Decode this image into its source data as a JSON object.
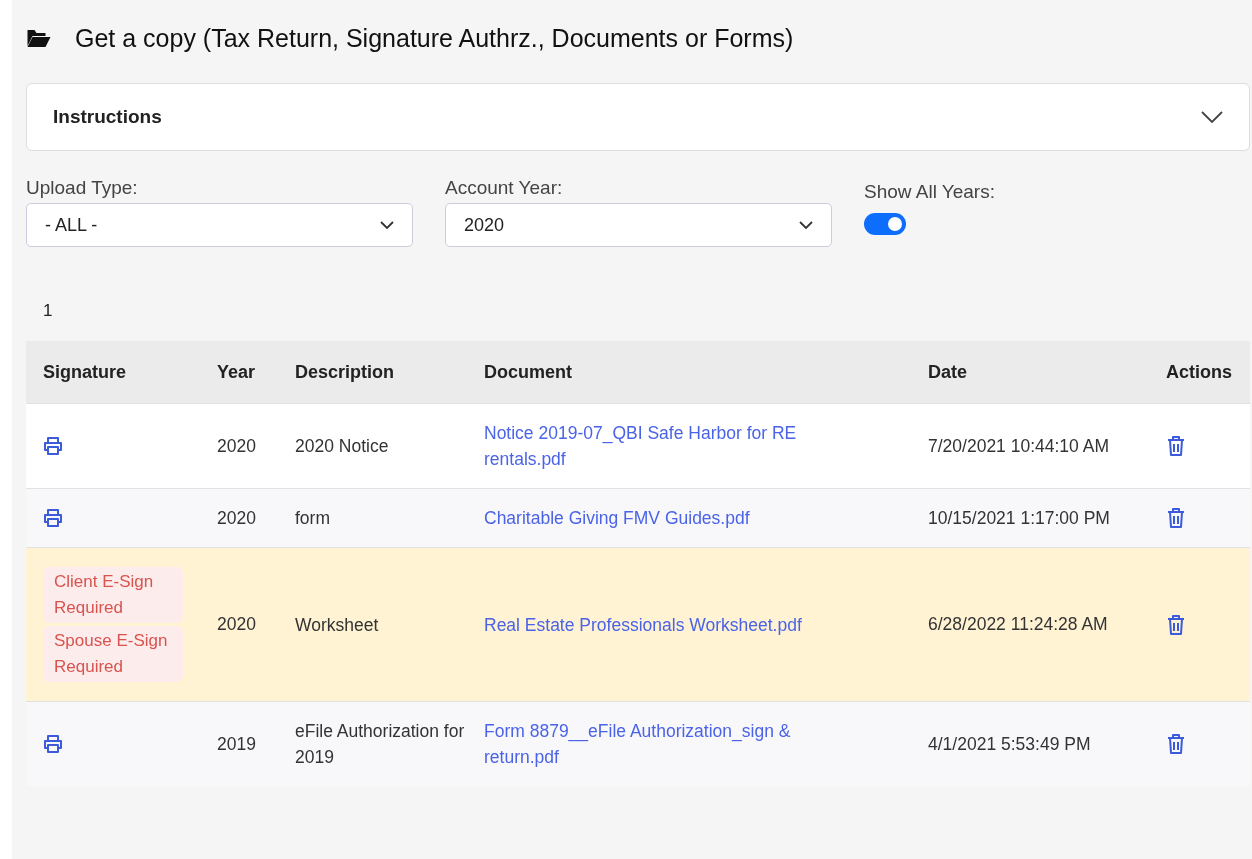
{
  "title": "Get a copy (Tax Return, Signature Authrz., Documents or Forms)",
  "instructions": {
    "label": "Instructions",
    "expanded": false
  },
  "filters": {
    "upload_type": {
      "label": "Upload Type:",
      "value": "- ALL -"
    },
    "account_year": {
      "label": "Account Year:",
      "value": "2020"
    },
    "show_all_years": {
      "label": "Show All Years:",
      "on": true
    }
  },
  "pagination": [
    "1"
  ],
  "table": {
    "columns": [
      "Signature",
      "Year",
      "Description",
      "Document",
      "Date",
      "Actions"
    ],
    "rows": [
      {
        "printable": true,
        "badges": [],
        "year": "2020",
        "description": "2020 Notice",
        "document": "Notice 2019-07_QBI Safe Harbor for RE rentals.pdf",
        "date": "7/20/2021 10:44:10 AM",
        "highlighted": false
      },
      {
        "printable": true,
        "badges": [],
        "year": "2020",
        "description": "form",
        "document": "Charitable Giving FMV Guides.pdf",
        "date": "10/15/2021 1:17:00 PM",
        "highlighted": false
      },
      {
        "printable": false,
        "badges": [
          "Client E-Sign Required",
          "Spouse E-Sign Required"
        ],
        "year": "2020",
        "description": "Worksheet",
        "document": "Real Estate Professionals Worksheet.pdf",
        "date": "6/28/2022 11:24:28 AM",
        "highlighted": true
      },
      {
        "printable": true,
        "badges": [],
        "year": "2019",
        "description": "eFile Authorization for 2019",
        "document": "Form 8879__eFile Authorization_sign & return.pdf",
        "date": "4/1/2021 5:53:49 PM",
        "highlighted": false
      }
    ]
  }
}
